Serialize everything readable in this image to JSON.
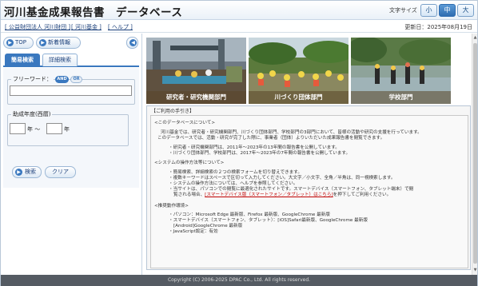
{
  "header": {
    "title": "河川基金成果報告書　データベース",
    "font_size_label": "文字サイズ",
    "font_sizes": [
      "小",
      "中",
      "大"
    ],
    "font_size_selected": "中"
  },
  "orgbar": {
    "links": [
      "[ 公益財団法人 河川財団 ]",
      "[ 河川基金 ]",
      "[ ヘルプ ]"
    ],
    "updated": "更新日：2025年08月19日"
  },
  "nav": {
    "top_label": "TOP",
    "new_label": "新着情報"
  },
  "tabs": [
    "簡易検索",
    "詳細検索"
  ],
  "form": {
    "freeword_label": "フリーワード：",
    "and_label": "AND",
    "or_label": "OR",
    "freeword_value": "",
    "year_label": "助成年度(西暦)",
    "year_from": "",
    "year_unit_from": "年 ～",
    "year_to": "",
    "year_unit_to": "年",
    "search_label": "検索",
    "clear_label": "クリア"
  },
  "photos": [
    {
      "caption": "研究者・研究機関部門"
    },
    {
      "caption": "川づくり団体部門"
    },
    {
      "caption": "学校部門"
    }
  ],
  "info": {
    "title": "【ご利用の手引き】",
    "about_heading": "<このデータベースについて>",
    "about_text1": "河川基金では、研究者・研究機関部門、川づくり団体部門、学校部門の3部門において、皆様の活動や研究の支援を行っています。",
    "about_text2": "このデータベースでは、活動・研究が完了した際に、事業者（団体）よりいただいた成果報告書を閲覧できます。",
    "about_items": [
      "研究者・研究機関部門は、2011年～2023年の13年間の報告書を公開しています。",
      "川づくり団体部門、学校部門は、2017年～2023年の7年間の報告書を公開しています。"
    ],
    "ops_heading": "<システムの操作方法等について>",
    "ops_items": [
      "簡易検索、詳細検索の２つの検索フォームを切り替えできます。",
      "複数キーワードはスペースで区切って入力してください。大文字／小文字、全角／半角は、同一視検索します。",
      "システムの操作方法については、ヘルプを参照してください。",
      "当サイトは、パソコンでの閲覧に最適化されたサイトです。スマートデバイス（スマートフォン、タブレット端末）で閲"
    ],
    "ops_cont": "覧される場合、",
    "smart_link": "[スマートデバイス版（スマートフォン／タブレット）はこちら]",
    "ops_cont2": "を押下してご利用ください。",
    "env_heading": "<推奨動作環境>",
    "env_items": [
      "パソコン：Microsoft Edge 最新版、Firefox 最新版、GoogleChrome 最新版",
      "スマートデバイス（スマートフォン、タブレット）：[iOS]Safari最新版、GoogleChrome 最新版",
      "[Android]GoogleChrome 最新版",
      "JavaScript設定：有効"
    ]
  },
  "footer": {
    "text": "Copyright (C) 2006-2025 DPAC Co., Ltd. All rights reserved."
  },
  "colors": {
    "accent": "#3a78bf",
    "link_red": "#c00000",
    "footer_bg": "#555b63"
  }
}
